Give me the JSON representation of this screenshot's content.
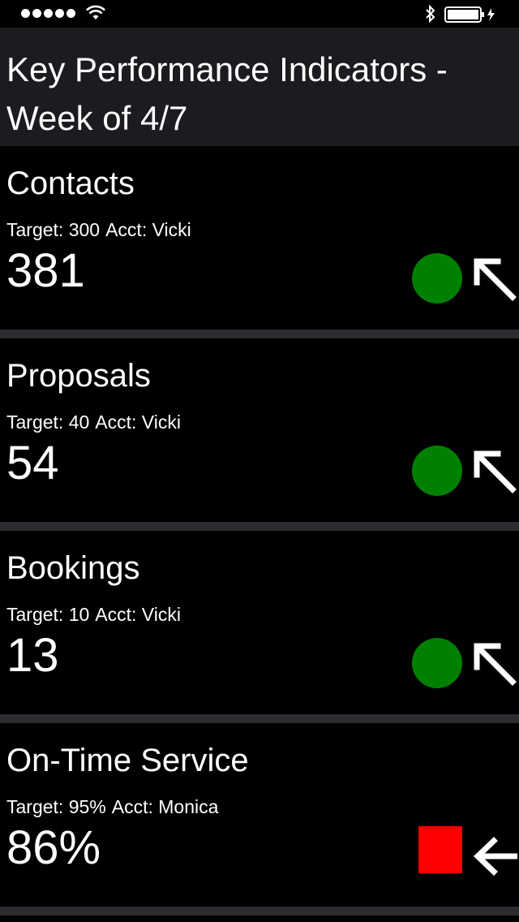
{
  "header": {
    "title": "Key Performance Indicators - Week of 4/7"
  },
  "status_bar": {
    "signal_bars": 5,
    "icons": [
      "signal-dots-icon",
      "wifi-icon",
      "bluetooth-icon",
      "battery-charging-icon"
    ]
  },
  "colors": {
    "good": "#008000",
    "bad": "#ff0000",
    "header_bg": "#1b1c1f",
    "divider": "#2b2c30"
  },
  "kpis": [
    {
      "name": "Contacts",
      "target": "Target: 300",
      "acct": "Acct: Vicki",
      "value": "381",
      "status": "good",
      "status_shape": "circle",
      "status_color": "#008000",
      "trend_icon": "arrow-up-left-icon"
    },
    {
      "name": "Proposals",
      "target": "Target: 40",
      "acct": "Acct: Vicki",
      "value": "54",
      "status": "good",
      "status_shape": "circle",
      "status_color": "#008000",
      "trend_icon": "arrow-up-left-icon"
    },
    {
      "name": "Bookings",
      "target": "Target: 10",
      "acct": "Acct: Vicki",
      "value": "13",
      "status": "good",
      "status_shape": "circle",
      "status_color": "#008000",
      "trend_icon": "arrow-up-left-icon"
    },
    {
      "name": "On-Time Service",
      "target": "Target: 95%",
      "acct": "Acct: Monica",
      "value": "86%",
      "status": "bad",
      "status_shape": "square",
      "status_color": "#ff0000",
      "trend_icon": "arrow-left-icon"
    }
  ]
}
